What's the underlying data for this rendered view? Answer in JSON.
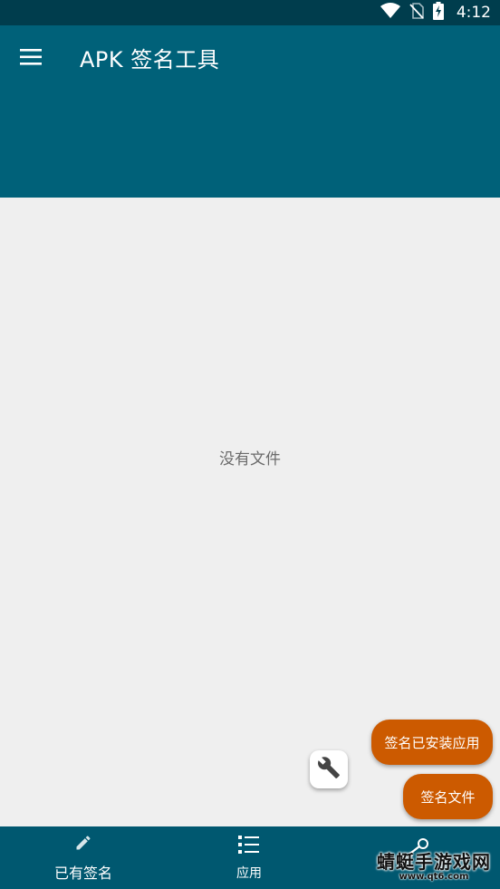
{
  "status_bar": {
    "time": "4:12",
    "icons": [
      "wifi-icon",
      "no-sim-icon",
      "battery-charging-icon"
    ]
  },
  "app_bar": {
    "title": "APK 签名工具",
    "menu_icon": "hamburger-menu-icon"
  },
  "main": {
    "empty_text": "没有文件"
  },
  "fab": {
    "tool_icon": "wrench-icon",
    "actions": [
      {
        "label": "签名已安装应用"
      },
      {
        "label": "签名文件"
      }
    ]
  },
  "bottom_nav": {
    "items": [
      {
        "label": "已有签名",
        "icon": "pencil-icon"
      },
      {
        "label": "应用",
        "icon": "list-icon"
      },
      {
        "label": "",
        "icon": "key-icon"
      }
    ]
  },
  "watermark": {
    "main": "蜻蜓手游戏网",
    "sub": "www.qt6.com"
  },
  "colors": {
    "status_bar": "#003d4d",
    "app_bar": "#006179",
    "bottom_nav": "#005870",
    "accent": "#cc5a00",
    "background": "#efefef"
  }
}
